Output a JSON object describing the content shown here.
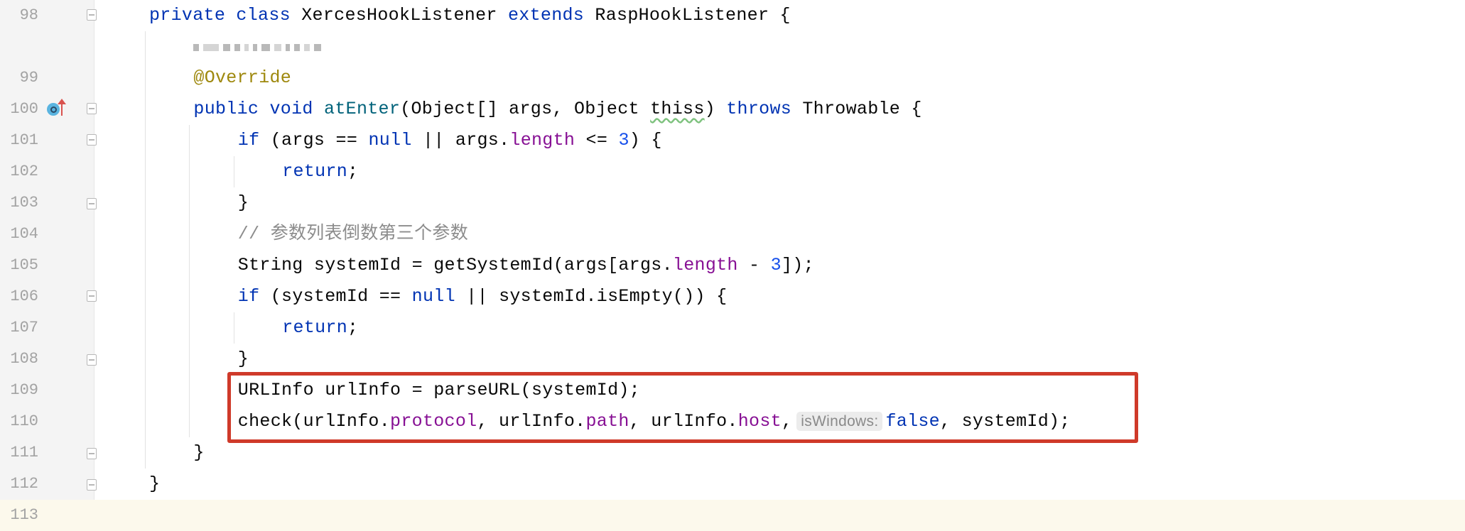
{
  "editor": {
    "colors": {
      "keyword": "#0033b3",
      "field": "#871094",
      "method_declaration": "#00627a",
      "annotation": "#9e880d",
      "comment": "#8c8c8c",
      "number": "#1750eb",
      "highlight_box": "#cf3a2a"
    },
    "lines": [
      {
        "number": "98",
        "indent": 0,
        "fold": "start",
        "tokens": [
          [
            "kw",
            "private class "
          ],
          [
            "",
            "XercesHookListener "
          ],
          [
            "kw",
            "extends "
          ],
          [
            "",
            "RaspHookListener {"
          ]
        ]
      },
      {
        "number": "",
        "indent": 1,
        "redacted": true,
        "tokens": []
      },
      {
        "number": "99",
        "indent": 1,
        "tokens": [
          [
            "ann",
            "@Override"
          ]
        ]
      },
      {
        "number": "100",
        "indent": 1,
        "fold": "start",
        "gutter_icons": [
          "implements-icon",
          "overrides-up-arrow-icon"
        ],
        "tokens": [
          [
            "kw",
            "public void "
          ],
          [
            "mdecl",
            "atEnter"
          ],
          [
            "",
            "(Object[] args, Object "
          ],
          [
            "warn",
            "thiss"
          ],
          [
            "",
            ") "
          ],
          [
            "kw",
            "throws "
          ],
          [
            "",
            "Throwable {"
          ]
        ]
      },
      {
        "number": "101",
        "indent": 2,
        "fold": "start",
        "tokens": [
          [
            "kw",
            "if "
          ],
          [
            "",
            "(args == "
          ],
          [
            "kw",
            "null "
          ],
          [
            "",
            "|| args."
          ],
          [
            "fld",
            "length"
          ],
          [
            "",
            " <= "
          ],
          [
            "num",
            "3"
          ],
          [
            "",
            ") {"
          ]
        ]
      },
      {
        "number": "102",
        "indent": 3,
        "tokens": [
          [
            "kw",
            "return"
          ],
          [
            "",
            ";"
          ]
        ]
      },
      {
        "number": "103",
        "indent": 2,
        "fold": "end",
        "tokens": [
          [
            "",
            "}"
          ]
        ]
      },
      {
        "number": "104",
        "indent": 2,
        "tokens": [
          [
            "cmt",
            "// 参数列表倒数第三个参数"
          ]
        ]
      },
      {
        "number": "105",
        "indent": 2,
        "tokens": [
          [
            "",
            "String systemId = getSystemId(args[args."
          ],
          [
            "fld",
            "length"
          ],
          [
            "",
            " - "
          ],
          [
            "num",
            "3"
          ],
          [
            "",
            "]);"
          ]
        ]
      },
      {
        "number": "106",
        "indent": 2,
        "fold": "start",
        "tokens": [
          [
            "kw",
            "if "
          ],
          [
            "",
            "(systemId == "
          ],
          [
            "kw",
            "null "
          ],
          [
            "",
            "|| systemId.isEmpty()) {"
          ]
        ]
      },
      {
        "number": "107",
        "indent": 3,
        "tokens": [
          [
            "kw",
            "return"
          ],
          [
            "",
            ";"
          ]
        ]
      },
      {
        "number": "108",
        "indent": 2,
        "fold": "end",
        "tokens": [
          [
            "",
            "}"
          ]
        ]
      },
      {
        "number": "109",
        "indent": 2,
        "tokens": [
          [
            "",
            "URLInfo urlInfo = parseURL(systemId);"
          ]
        ]
      },
      {
        "number": "110",
        "indent": 2,
        "tokens": [
          [
            "",
            "check(urlInfo."
          ],
          [
            "fld",
            "protocol"
          ],
          [
            "",
            ", urlInfo."
          ],
          [
            "fld",
            "path"
          ],
          [
            "",
            ", urlInfo."
          ],
          [
            "fld",
            "host"
          ],
          [
            "",
            ","
          ],
          [
            "hint",
            "isWindows:"
          ],
          [
            "kw",
            "false"
          ],
          [
            "",
            ", systemId);"
          ]
        ]
      },
      {
        "number": "111",
        "indent": 1,
        "fold": "end",
        "tokens": [
          [
            "",
            "}"
          ]
        ]
      },
      {
        "number": "112",
        "indent": 0,
        "fold": "end",
        "tokens": [
          [
            "",
            "}"
          ]
        ]
      },
      {
        "number": "113",
        "indent": 0,
        "caret": true,
        "tokens": []
      }
    ]
  }
}
